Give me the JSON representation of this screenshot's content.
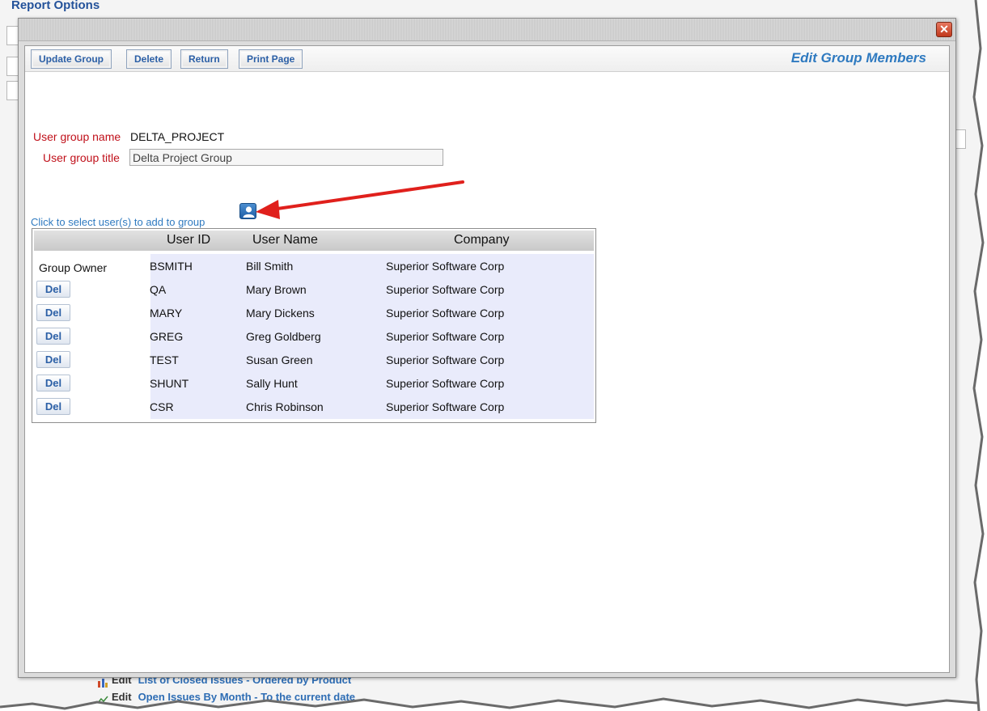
{
  "background": {
    "title": "Report Options",
    "links": [
      {
        "edit": "Edit",
        "text": "List of Closed Issues - Ordered by Product"
      },
      {
        "edit": "Edit",
        "text": "Open Issues By Month - To the current date"
      }
    ]
  },
  "dialog": {
    "close_glyph": "✕",
    "toolbar": {
      "update_label": "Update Group",
      "delete_label": "Delete",
      "return_label": "Return",
      "print_label": "Print Page"
    },
    "heading": "Edit Group Members",
    "group_name_label": "User group name",
    "group_name_value": "DELTA_PROJECT",
    "group_title_label": "User group title",
    "group_title_value": "Delta Project Group",
    "add_hint": "Click to select user(s) to add to group",
    "add_icon": "user-add-icon",
    "table": {
      "columns": [
        "User ID",
        "User Name",
        "Company"
      ],
      "owner_label": "Group Owner",
      "del_label": "Del",
      "rows": [
        {
          "user_id": "BSMITH",
          "user_name": "Bill Smith",
          "company": "Superior Software Corp"
        },
        {
          "user_id": "QA",
          "user_name": "Mary Brown",
          "company": "Superior Software Corp"
        },
        {
          "user_id": "MARY",
          "user_name": "Mary Dickens",
          "company": "Superior Software Corp"
        },
        {
          "user_id": "GREG",
          "user_name": "Greg Goldberg",
          "company": "Superior Software Corp"
        },
        {
          "user_id": "TEST",
          "user_name": "Susan Green",
          "company": "Superior Software Corp"
        },
        {
          "user_id": "SHUNT",
          "user_name": "Sally Hunt",
          "company": "Superior Software Corp"
        },
        {
          "user_id": "CSR",
          "user_name": "Chris Robinson",
          "company": "Superior Software Corp"
        }
      ]
    }
  },
  "colors": {
    "accent": "#2f7ac0",
    "label_red": "#c0101a",
    "arrow_red": "#e0201c",
    "row_tint": "#e9ebfb"
  }
}
